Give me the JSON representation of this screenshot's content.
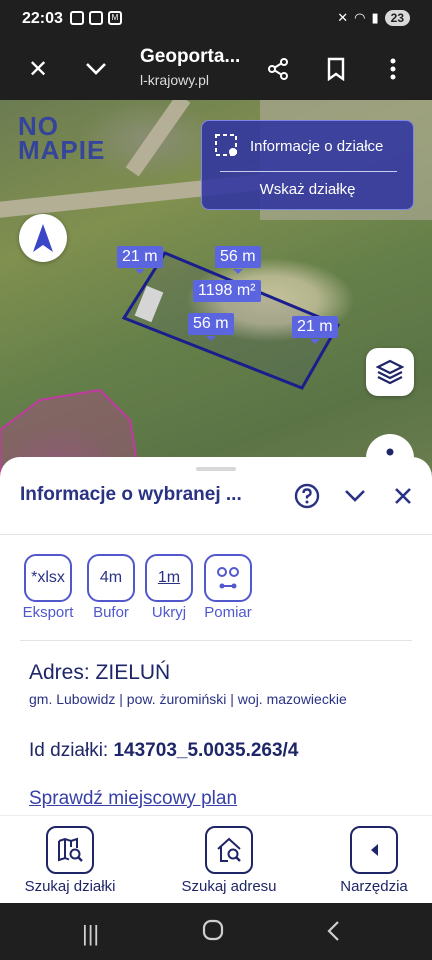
{
  "status": {
    "time": "22:03",
    "battery": "23"
  },
  "browser": {
    "title": "Geoporta...",
    "url": "l-krajowy.pl"
  },
  "map": {
    "logo_line1": "NO",
    "logo_line2": "MAPIE",
    "info_card": {
      "info_label": "Informacje o działce",
      "point_label": "Wskaż działkę"
    },
    "dimensions": {
      "top_left": "21 m",
      "top_right": "56 m",
      "area": "1198 m²",
      "bottom": "56 m",
      "right": "21 m"
    }
  },
  "sheet": {
    "title": "Informacje o wybranej ...",
    "tools": [
      {
        "icon_text": "*xlsx",
        "label": "Eksport"
      },
      {
        "icon_text": "4m",
        "label": "Bufor"
      },
      {
        "icon_text": "1m",
        "label": "Ukryj"
      },
      {
        "icon_text": "",
        "label": "Pomiar"
      }
    ],
    "address": "Adres: ZIELUŃ",
    "admin": "gm. Lubowidz | pow. żuromiński | woj. mazowieckie",
    "parcel_label": "Id działki:",
    "parcel_id": "143703_5.0035.263/4",
    "plan_link": "Sprawdź miejscowy plan"
  },
  "nav": [
    {
      "label": "Szukaj działki"
    },
    {
      "label": "Szukaj adresu"
    },
    {
      "label": "Narzędzia"
    }
  ],
  "colors": {
    "accent": "#5058cc",
    "dark": "#1f2668",
    "dim_label": "#5b65e0",
    "card": "#3034a0"
  }
}
